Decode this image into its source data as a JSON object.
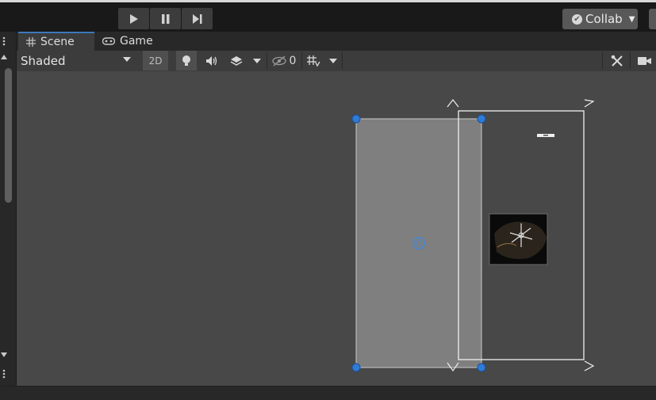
{
  "toolbar": {
    "play_icon": "play-icon",
    "pause_icon": "pause-icon",
    "step_icon": "step-icon",
    "collab_label": "Collab"
  },
  "tabs": [
    {
      "label": "Scene",
      "icon": "grid-icon",
      "active": true
    },
    {
      "label": "Game",
      "icon": "gamepad-icon",
      "active": false
    }
  ],
  "scene_toolbar": {
    "draw_mode": "Shaded",
    "mode_2d_label": "2D",
    "hidden_count": "0"
  },
  "colors": {
    "accent": "#3a79bb",
    "handle": "#2f7bd8",
    "scene_bg": "#484848",
    "rect_fill": "#7f7f7f"
  }
}
